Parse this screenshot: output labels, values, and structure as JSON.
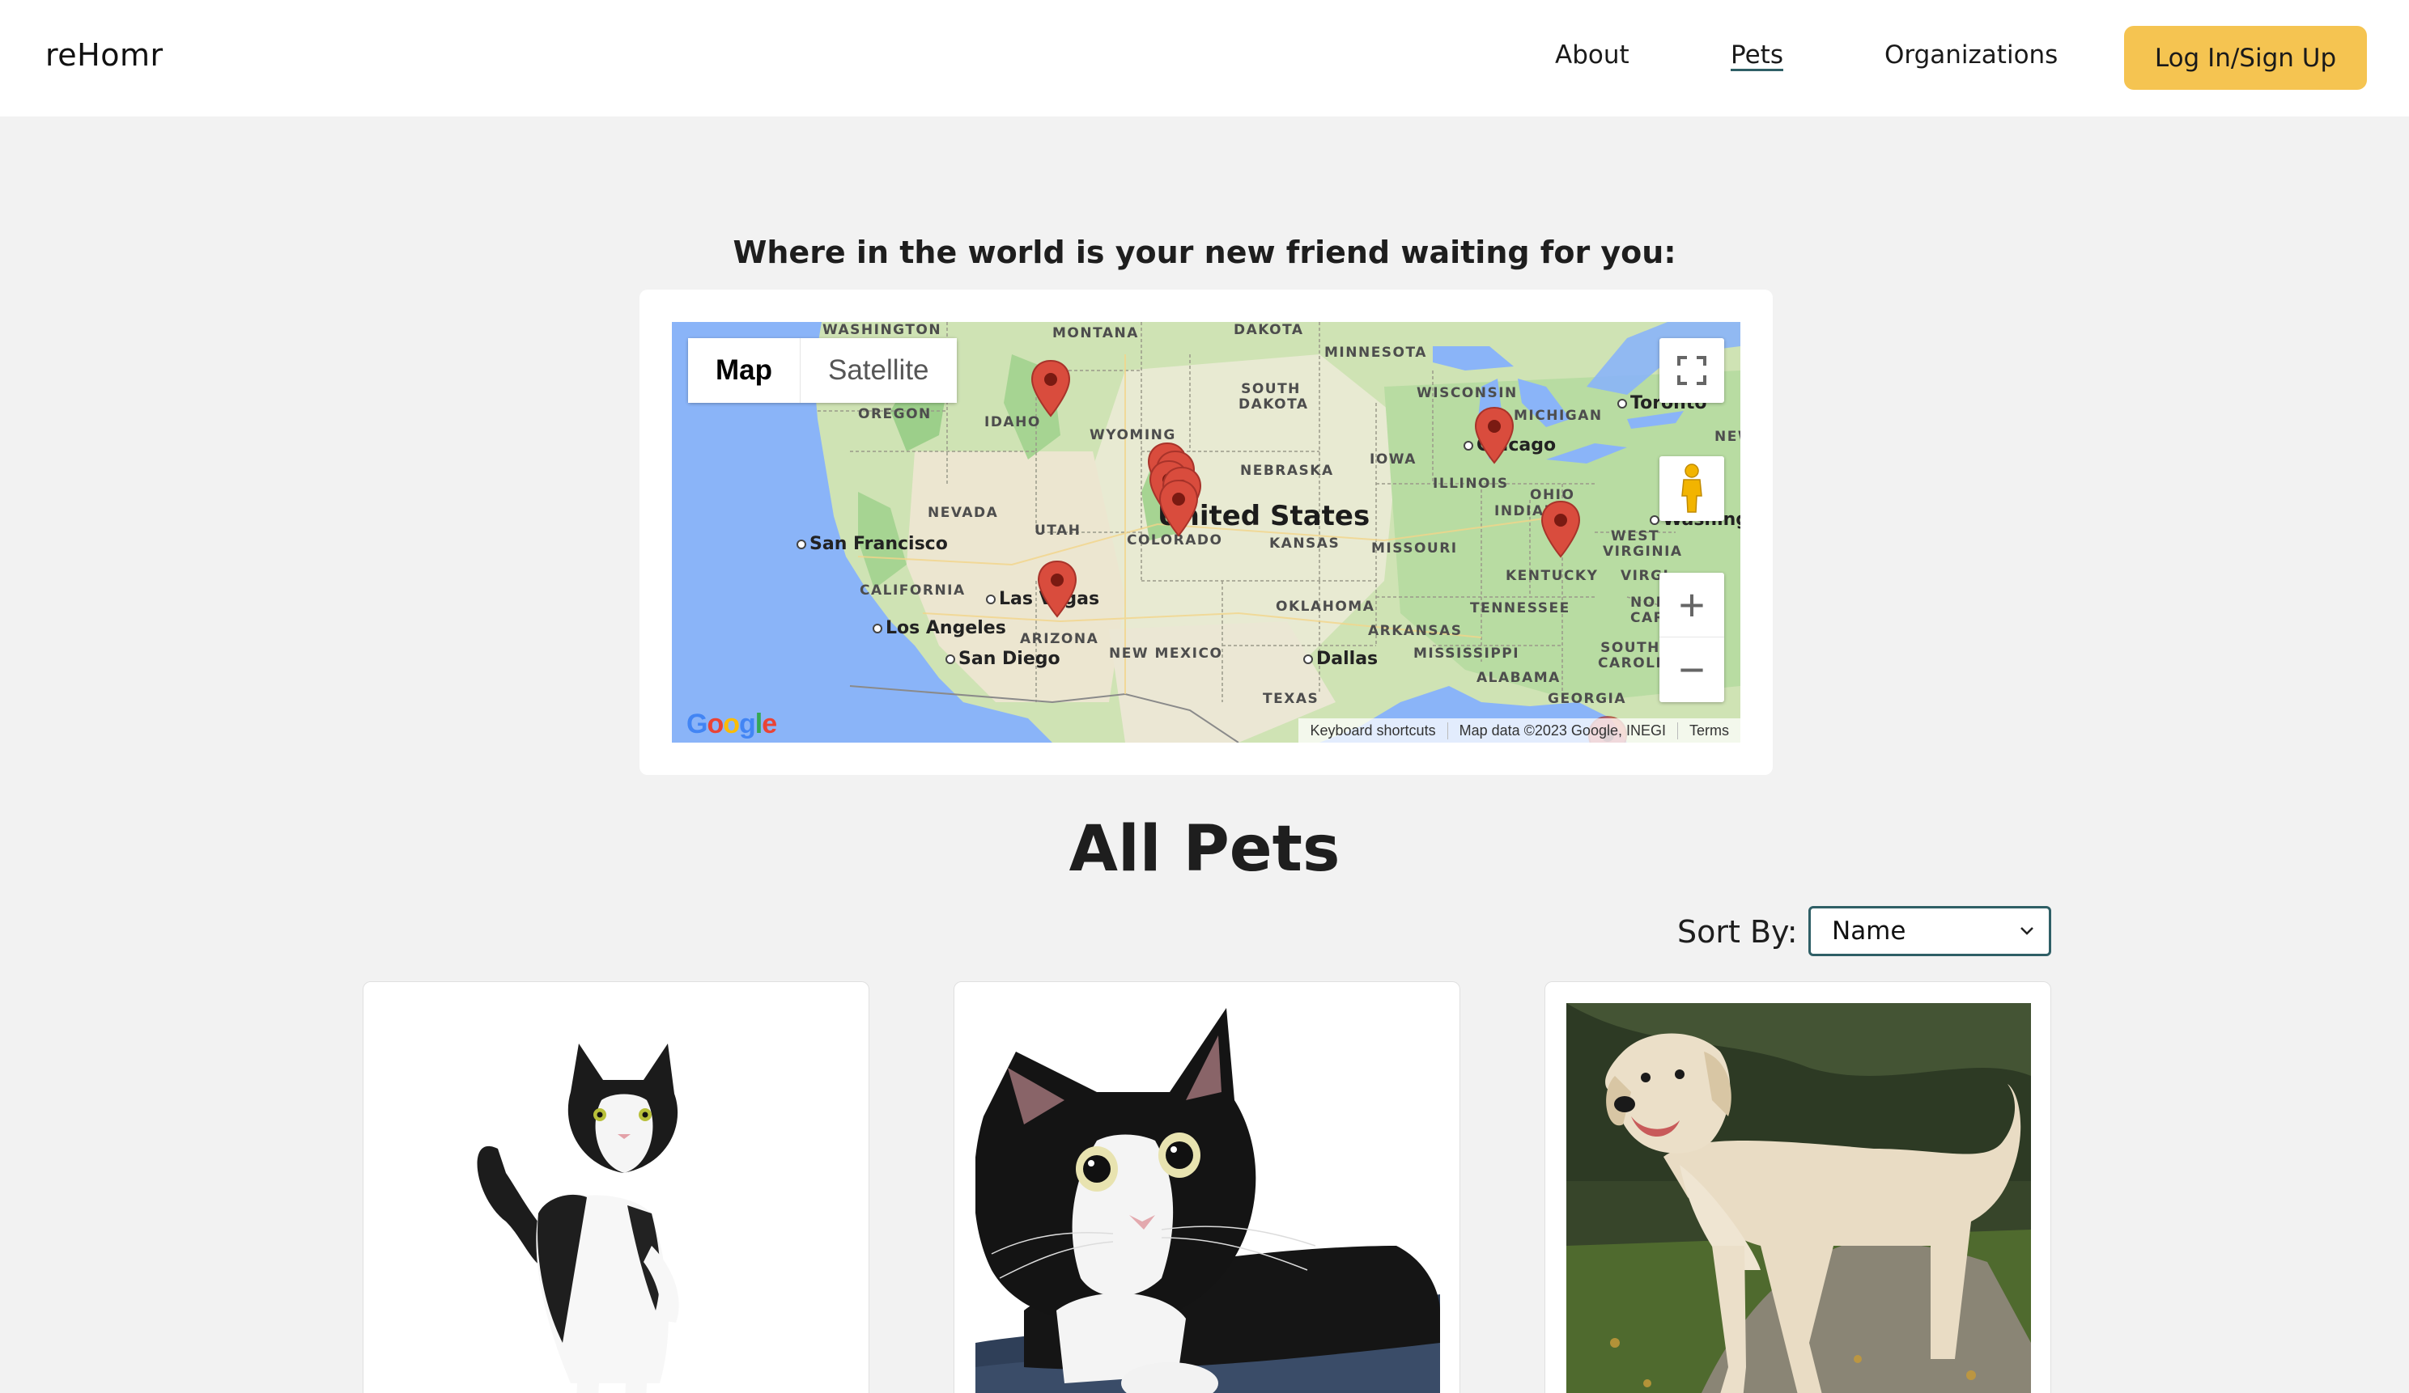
{
  "brand": "reHomr",
  "nav": {
    "about": "About",
    "pets": "Pets",
    "organizations": "Organizations",
    "login": "Log In/Sign Up"
  },
  "map_section": {
    "heading": "Where in the world is your new friend waiting for you:",
    "map_type": {
      "map": "Map",
      "satellite": "Satellite"
    },
    "country_label": "United States",
    "state_labels": [
      "WASHINGTON",
      "MONTANA",
      "DAKOTA",
      "MINNESOTA",
      "SOUTH DAKOTA",
      "WISCONSIN",
      "MICHIGAN",
      "OREGON",
      "IDAHO",
      "WYOMING",
      "NEBRASKA",
      "IOWA",
      "ILLINOIS",
      "OHIO",
      "INDIANA",
      "NEVADA",
      "UTAH",
      "COLORADO",
      "KANSAS",
      "MISSOURI",
      "KENTUCKY",
      "WEST VIRGINIA",
      "CALIFORNIA",
      "ARIZONA",
      "OKLAHOMA",
      "ARKANSAS",
      "TENNESSEE",
      "NEW MEXICO",
      "MISSISSIPPI",
      "ALABAMA",
      "GEORGIA",
      "TEXAS",
      "NEW YOR",
      "VIRGI",
      "NOR CARO",
      "SOUTH CAROLIN"
    ],
    "city_labels": [
      "San Francisco",
      "Los Angeles",
      "San Diego",
      "Las Vegas",
      "Dallas",
      "Chicago",
      "Toronto",
      "Washington"
    ],
    "attribution": {
      "shortcuts": "Keyboard shortcuts",
      "data": "Map data ©2023 Google, INEGI",
      "terms": "Terms"
    },
    "logo": "Google"
  },
  "pets_section": {
    "title": "All Pets",
    "sort_label": "Sort By:",
    "sort_value": "Name"
  },
  "pets": [
    {
      "image": "black-and-white-cat-standing"
    },
    {
      "image": "tuxedo-cat-closeup"
    },
    {
      "image": "golden-retriever"
    }
  ],
  "colors": {
    "accent": "#f5c451",
    "nav_underline": "#2f5f66",
    "background": "#f2f2f2",
    "pin": "#d94c3d"
  }
}
